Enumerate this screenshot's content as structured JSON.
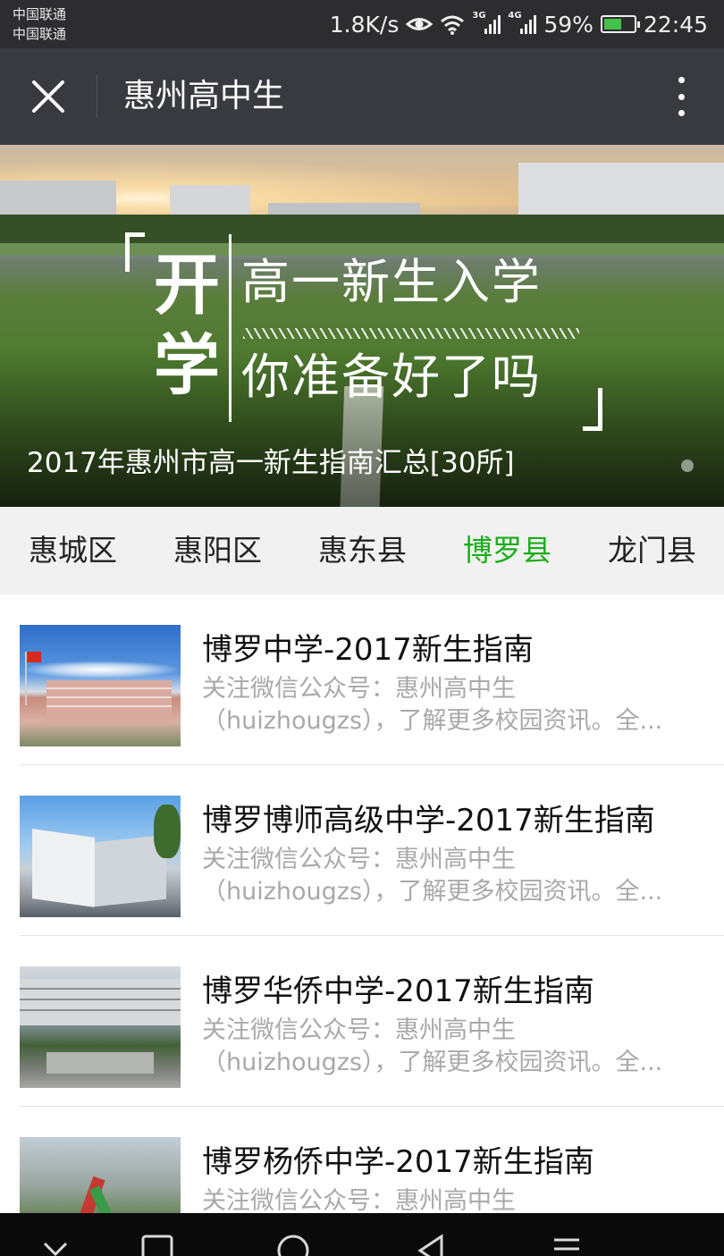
{
  "status_bar": {
    "carrier_1": "中国联通",
    "carrier_2": "中国联通",
    "net_speed": "1.8K/s",
    "signal_1_tag": "3G",
    "signal_2_tag": "4G",
    "battery": "59%",
    "battery_level": 0.59,
    "time": "22:45",
    "icons": [
      "eye-icon",
      "wifi-icon",
      "signal-icon",
      "battery-icon"
    ]
  },
  "title_bar": {
    "title": "惠州高中生",
    "icons": [
      "close-icon",
      "more-vertical-icon"
    ]
  },
  "banner": {
    "kai": "开",
    "xue": "学",
    "headline_1": "高一新生入学",
    "headline_2": "你准备好了吗",
    "caption": "2017年惠州市高一新生指南汇总[30所]"
  },
  "tabs": [
    {
      "label": "惠城区",
      "active": false
    },
    {
      "label": "惠阳区",
      "active": false
    },
    {
      "label": "惠东县",
      "active": false
    },
    {
      "label": "博罗县",
      "active": true
    },
    {
      "label": "龙门县",
      "active": false
    }
  ],
  "articles": [
    {
      "title": "博罗中学-2017新生指南",
      "desc_line_1": "关注微信公众号：惠州高中生",
      "desc_line_2": "（huizhougzs），了解更多校园资讯。全..."
    },
    {
      "title": "博罗博师高级中学-2017新生指南",
      "desc_line_1": "关注微信公众号：惠州高中生",
      "desc_line_2": "（huizhougzs），了解更多校园资讯。全..."
    },
    {
      "title": "博罗华侨中学-2017新生指南",
      "desc_line_1": "关注微信公众号：惠州高中生",
      "desc_line_2": "（huizhougzs），了解更多校园资讯。全..."
    },
    {
      "title": "博罗杨侨中学-2017新生指南",
      "desc_line_1": "关注微信公众号：惠州高中生",
      "desc_line_2": ""
    }
  ],
  "nav_bar": {
    "icons": [
      "chevron-down-icon",
      "recents-icon",
      "home-icon",
      "back-icon",
      "menu-icon"
    ]
  },
  "colors": {
    "title_bar_bg": "#393a3f",
    "active_tab": "#1aad19",
    "tab_bar_bg": "#f1f1f1",
    "desc_text": "#a9a9a9"
  }
}
